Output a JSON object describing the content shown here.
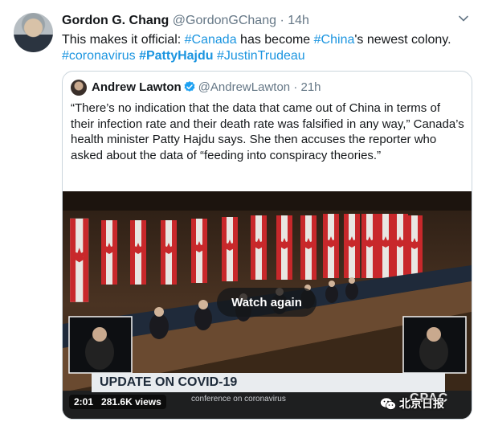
{
  "tweet": {
    "author_name": "Gordon G. Chang",
    "author_handle": "@GordonGChang",
    "separator": "·",
    "time": "14h",
    "text_prefix": "This makes it official: ",
    "hashtag_canada": "#Canada",
    "text_middle": " has become ",
    "hashtag_china": "#China",
    "text_suffix": "'s newest colony.",
    "hashtag_coronavirus": "#coronavirus",
    "hashtag_pattyhajdu": "#PattyHajdu",
    "hashtag_justintrudeau": "#JustinTrudeau",
    "menu_icon": "chevron-down-icon"
  },
  "quoted": {
    "author_name": "Andrew Lawton",
    "verified_icon": "verified-badge-icon",
    "author_handle": "@AndrewLawton",
    "separator": "·",
    "time": "21h",
    "text": "“There’s no indication that the data that came out of China in terms of their infection rate and their death rate was falsified in any way,” Canada’s health minister Patty Hajdu says. She then accuses the reporter who asked about the data of “feeding into conspiracy theories.”"
  },
  "video": {
    "watch_again": "Watch again",
    "banner": "UPDATE ON COVID-19",
    "banner_subtitle": "conference on coronavirus",
    "channel_logo": "CPAC",
    "duration": "2:01",
    "views": "281.6K views"
  },
  "watermark": {
    "icon": "wechat-icon",
    "text": "北京日报"
  },
  "colors": {
    "link": "#1b95e0",
    "text": "#14171a",
    "muted": "#657786",
    "border": "#ccd6dd",
    "verified": "#1da1f2"
  }
}
